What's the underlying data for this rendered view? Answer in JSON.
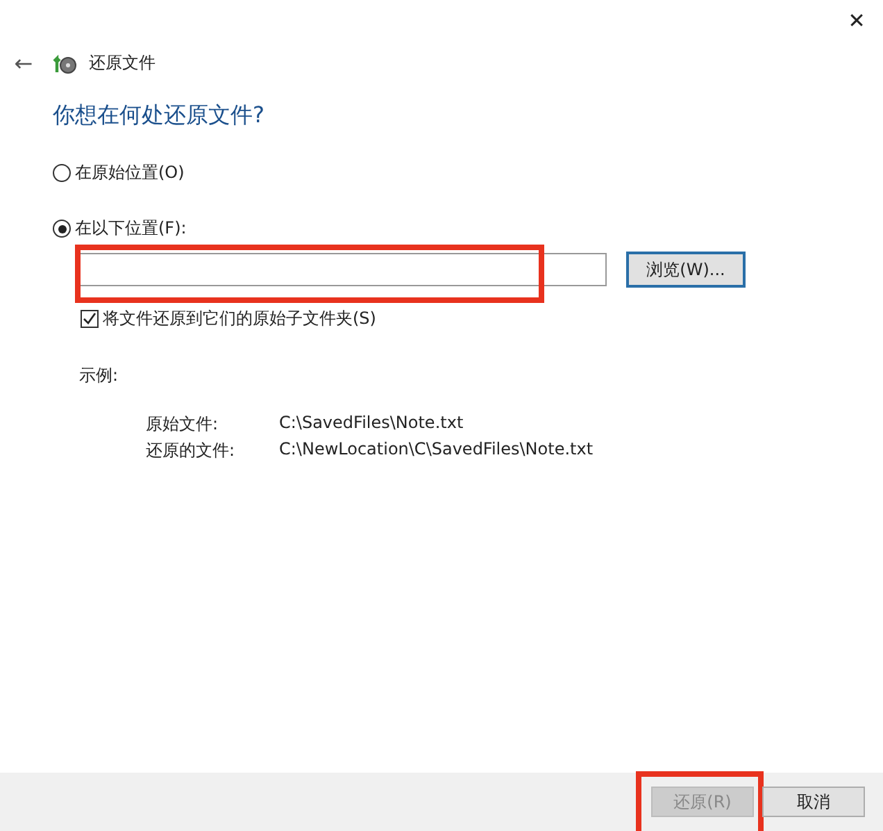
{
  "window": {
    "close": "✕",
    "back": "←",
    "title": "还原文件"
  },
  "heading": "你想在何处还原文件?",
  "options": [
    {
      "label": "在原始位置(O)",
      "selected": false
    },
    {
      "label": "在以下位置(F):",
      "selected": true
    }
  ],
  "location": {
    "browse": "浏览(W)..."
  },
  "subfolders": {
    "label": "将文件还原到它们的原始子文件夹(S)",
    "checked": true
  },
  "example": {
    "title": "示例:",
    "rows": [
      {
        "label": "原始文件:",
        "path": "C:\\SavedFiles\\Note.txt"
      },
      {
        "label": "还原的文件:",
        "path": "C:\\NewLocation\\C\\SavedFiles\\Note.txt"
      }
    ]
  },
  "buttons": [
    {
      "label": "还原(R)",
      "disabled": true
    },
    {
      "label": "取消",
      "disabled": false
    }
  ]
}
